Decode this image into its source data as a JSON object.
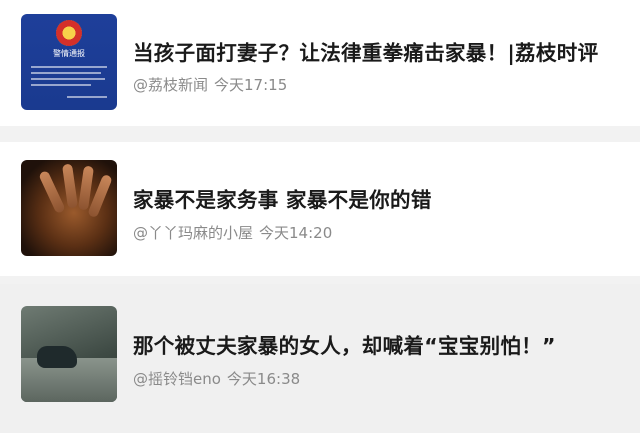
{
  "feed": {
    "items": [
      {
        "title": "当孩子面打妻子？让法律重拳痛击家暴！|荔枝时评",
        "source": "@荔枝新闻",
        "time": "今天17:15",
        "thumbnail": {
          "heading": "警情通报"
        }
      },
      {
        "title": "家暴不是家务事 家暴不是你的错",
        "source": "@丫丫玛麻的小屋",
        "time": "今天14:20",
        "thumbnail": {}
      },
      {
        "title": "那个被丈夫家暴的女人，却喊着“宝宝别怕！”",
        "source": "@摇铃铛eno",
        "time": "今天16:38",
        "thumbnail": {}
      }
    ]
  },
  "colors": {
    "page_background": "#f2f2f2",
    "card_background": "#ffffff",
    "title": "#1a1a1a",
    "meta": "#8a8a8a"
  },
  "icons": {
    "item_1_thumbnail": "police-notice-image",
    "item_2_thumbnail": "hand-poster-image",
    "item_3_thumbnail": "cctv-scene-image"
  }
}
